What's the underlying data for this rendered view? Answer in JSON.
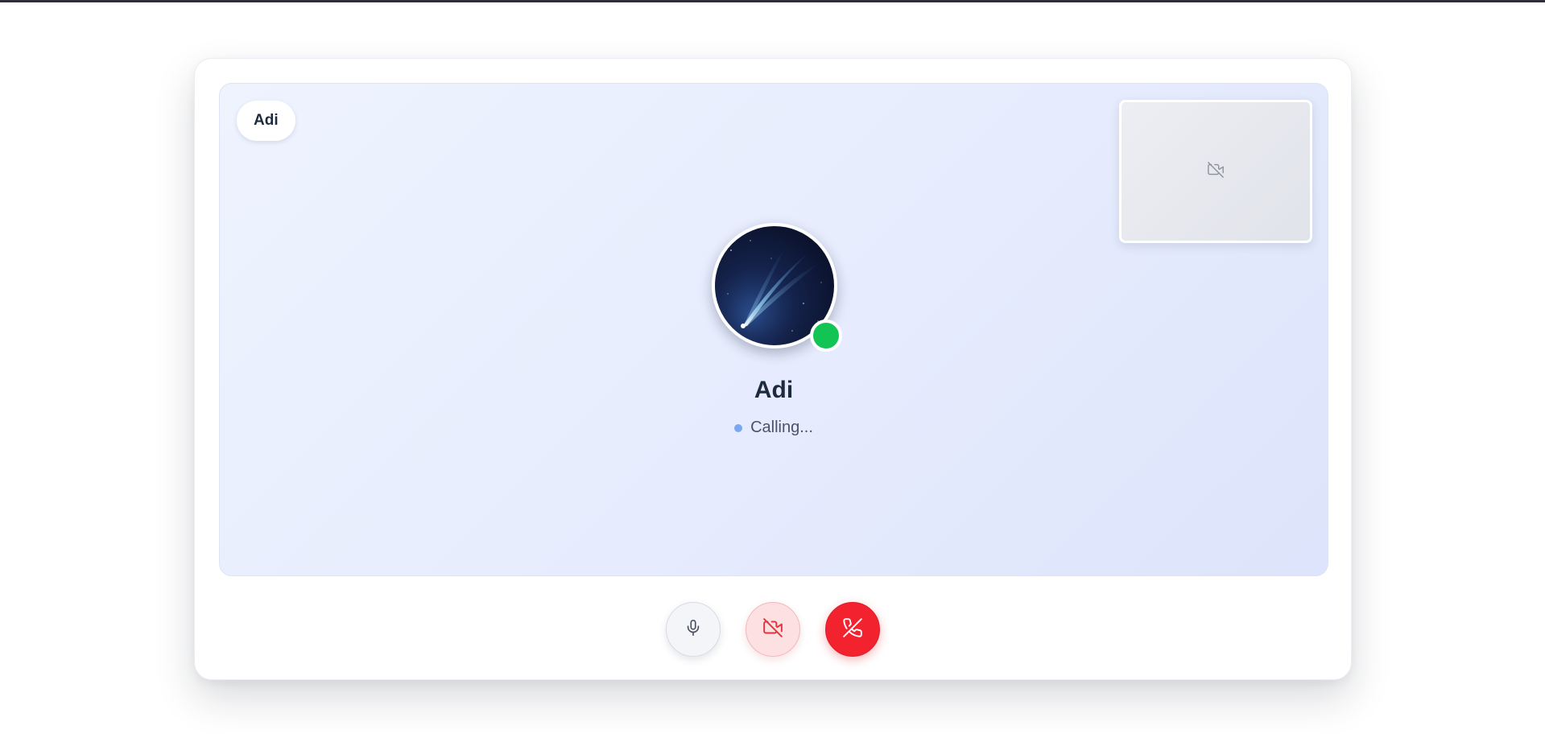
{
  "header": {
    "participant_chip": "Adi"
  },
  "caller": {
    "name": "Adi",
    "status": "Calling...",
    "avatar": "comet-night-sky-image",
    "presence": "online",
    "presence_color": "#12c454"
  },
  "self_view": {
    "icon": "video-off-icon"
  },
  "controls": [
    {
      "name": "mute-button",
      "icon": "microphone-icon"
    },
    {
      "name": "camera-toggle-button",
      "icon": "video-off-icon",
      "state": "off"
    },
    {
      "name": "end-call-button",
      "icon": "phone-off-icon"
    }
  ],
  "colors": {
    "end_call": "#f2232f",
    "camera_off_bg": "#fde0e1",
    "camera_off_icon": "#e5323d",
    "status_pulse": "#7ba7ef"
  }
}
